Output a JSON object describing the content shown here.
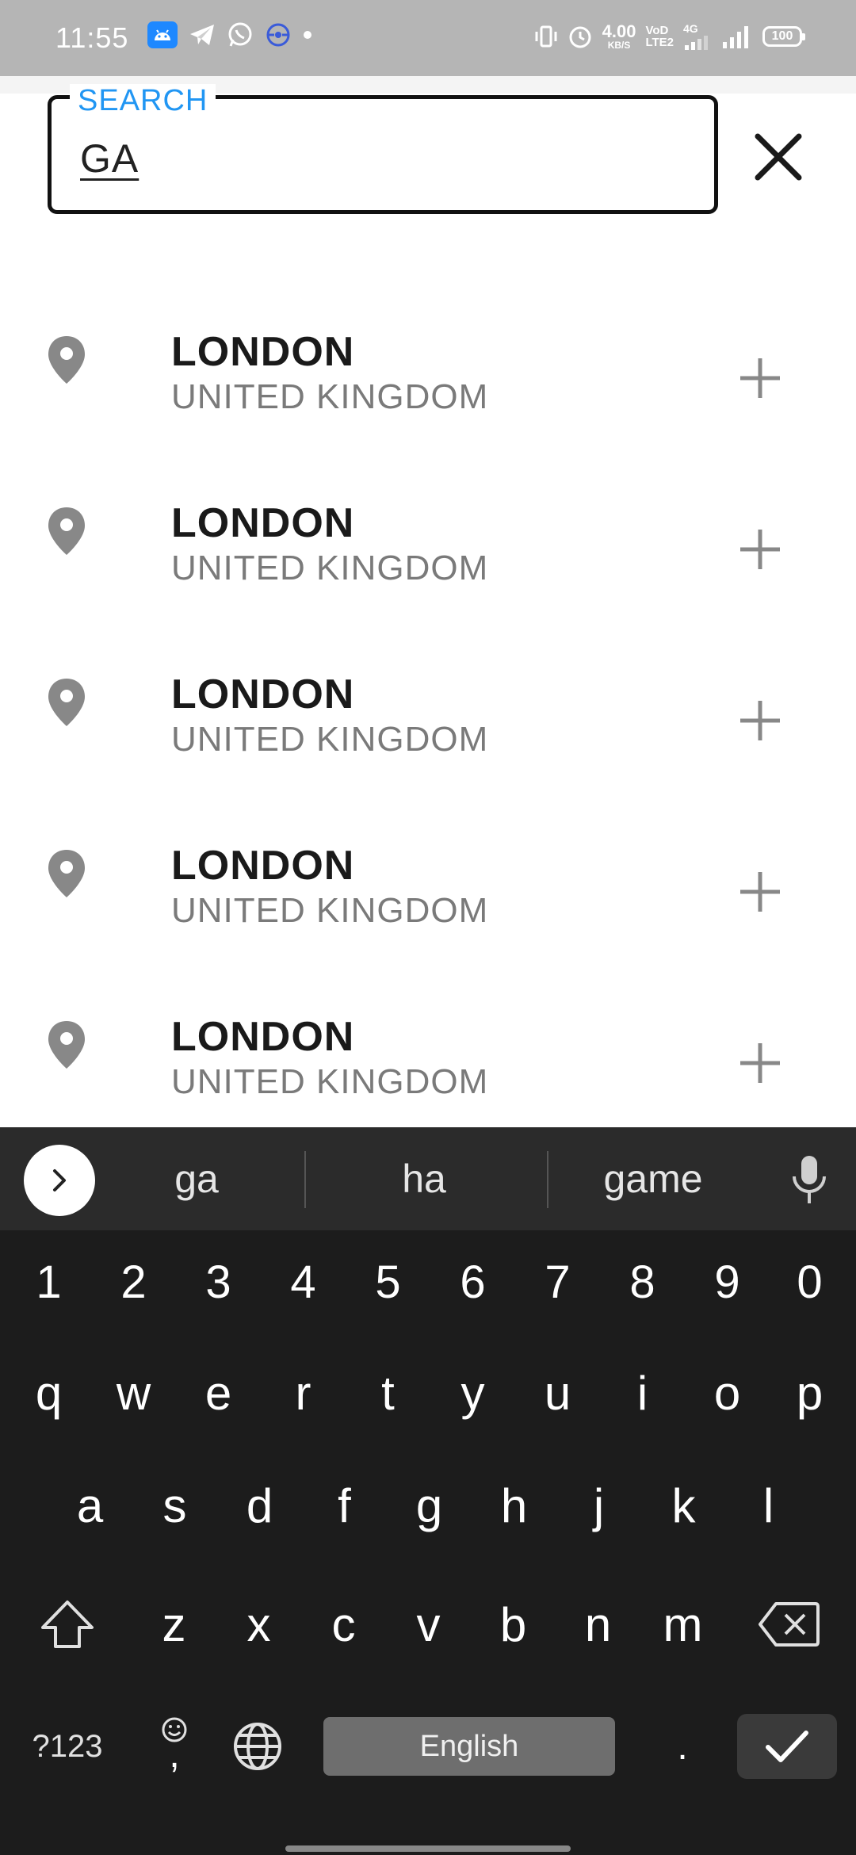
{
  "status_bar": {
    "time": "11:55",
    "net_speed_value": "4.00",
    "net_speed_unit": "KB/S",
    "volte_line1": "VoD",
    "volte_line2": "LTE2",
    "network_type": "4G",
    "battery": "100",
    "left_icons": [
      "android-icon",
      "telegram-icon",
      "whatsapp-icon",
      "screen-record-icon",
      "dot-icon"
    ],
    "right_icons": [
      "vibrate-icon",
      "alarm-icon",
      "signal-icon",
      "signal-icon"
    ]
  },
  "search": {
    "label": "SEARCH",
    "value": "GA"
  },
  "results": [
    {
      "city": "LONDON",
      "country": "UNITED KINGDOM"
    },
    {
      "city": "LONDON",
      "country": "UNITED KINGDOM"
    },
    {
      "city": "LONDON",
      "country": "UNITED KINGDOM"
    },
    {
      "city": "LONDON",
      "country": "UNITED KINGDOM"
    },
    {
      "city": "LONDON",
      "country": "UNITED KINGDOM"
    }
  ],
  "keyboard": {
    "suggestions": [
      "ga",
      "ha",
      "game"
    ],
    "number_row": [
      "1",
      "2",
      "3",
      "4",
      "5",
      "6",
      "7",
      "8",
      "9",
      "0"
    ],
    "row1": [
      "q",
      "w",
      "e",
      "r",
      "t",
      "y",
      "u",
      "i",
      "o",
      "p"
    ],
    "row2": [
      "a",
      "s",
      "d",
      "f",
      "g",
      "h",
      "j",
      "k",
      "l"
    ],
    "row3": [
      "z",
      "x",
      "c",
      "v",
      "b",
      "n",
      "m"
    ],
    "symbols_key": "?123",
    "comma_key": ",",
    "period_key": ".",
    "space_label": "English"
  },
  "colors": {
    "accent": "#2196f3",
    "status_bar": "#b5b5b5",
    "keyboard_bg": "#1c1c1c",
    "icon_gray": "#888888"
  }
}
